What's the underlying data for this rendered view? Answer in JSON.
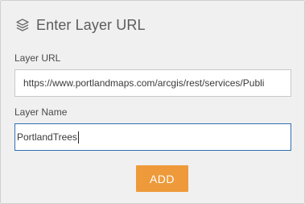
{
  "dialog": {
    "title": "Enter Layer URL",
    "icon": "layers-icon"
  },
  "url_field": {
    "label": "Layer URL",
    "value": "https://www.portlandmaps.com/arcgis/rest/services/Publi"
  },
  "name_field": {
    "label": "Layer Name",
    "value": "PortlandTrees"
  },
  "actions": {
    "add_label": "ADD"
  },
  "colors": {
    "accent": "#ee9a3a",
    "focus_border": "#2f6fb3",
    "panel_bg": "#f0f0f0"
  }
}
